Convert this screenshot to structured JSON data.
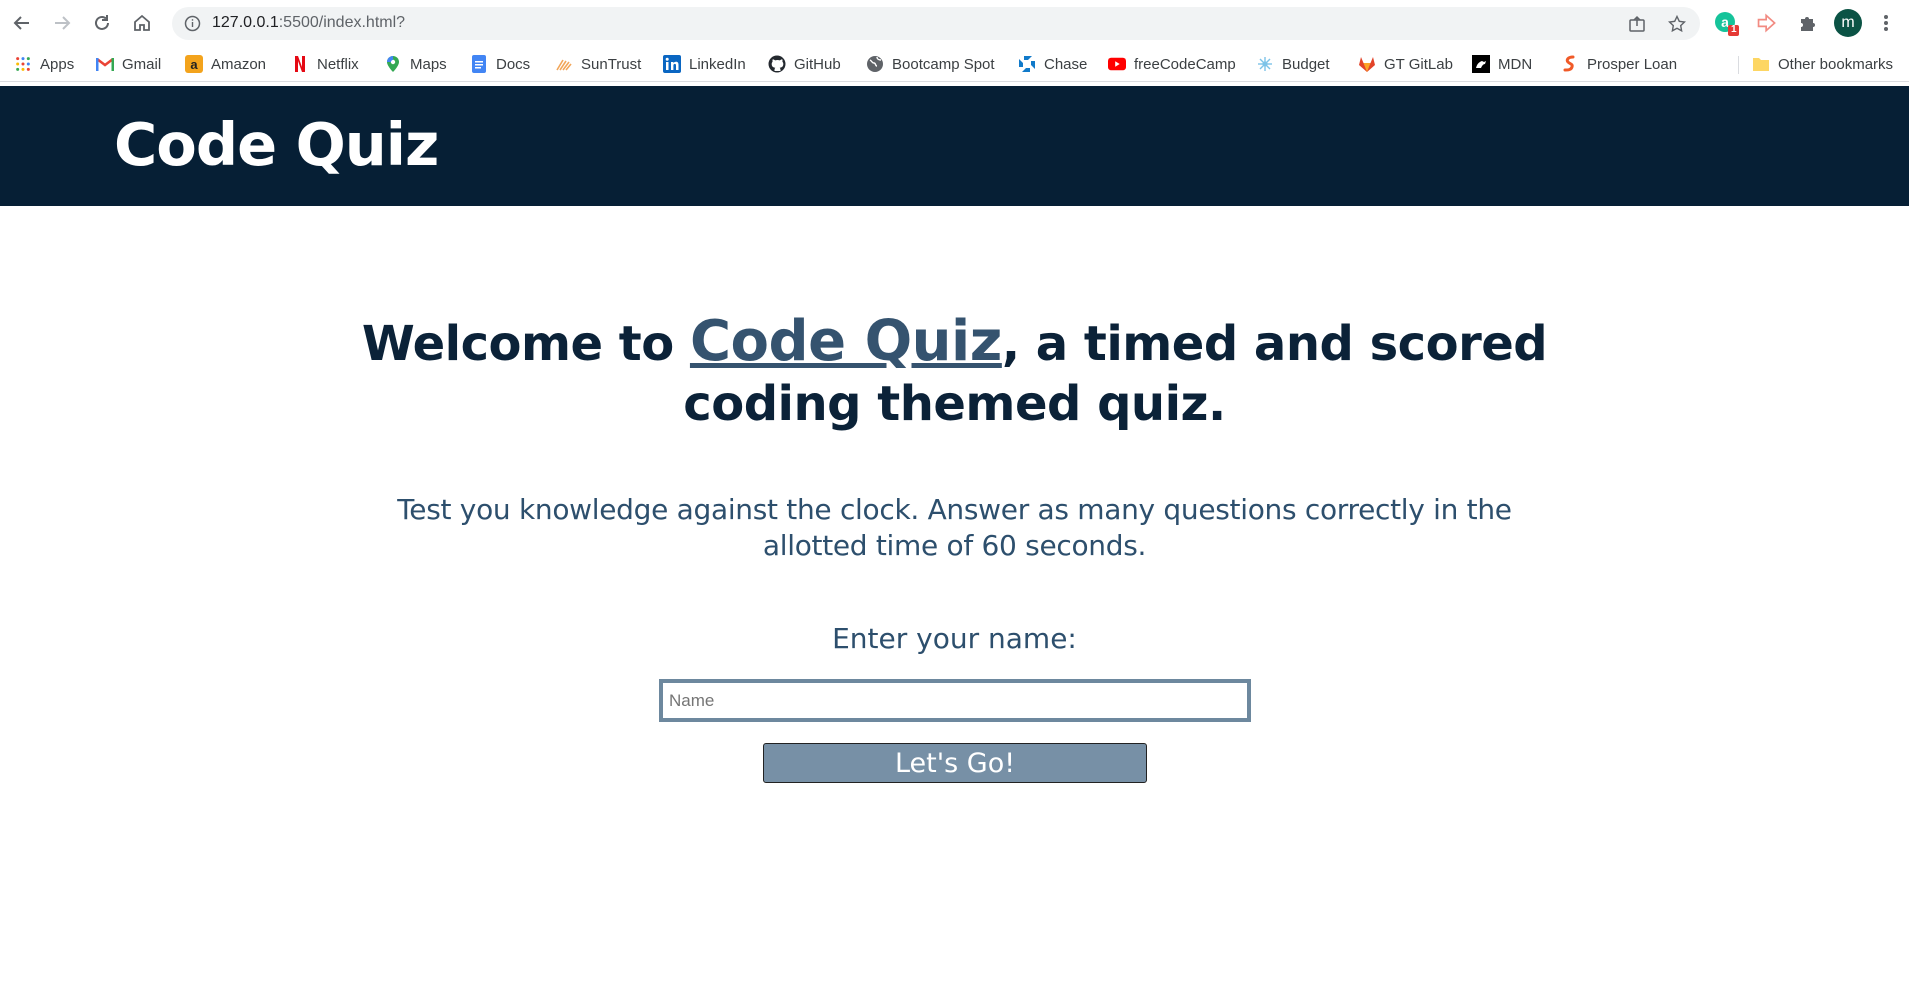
{
  "browser": {
    "url_host": "127.0.0.1",
    "url_rest": ":5500/index.html?",
    "avatar_letter": "m",
    "extension_badge": "1"
  },
  "bookmarks": [
    {
      "label": "Apps",
      "icon": "apps-grid-icon"
    },
    {
      "label": "Gmail",
      "icon": "gmail-icon"
    },
    {
      "label": "Amazon",
      "icon": "amazon-icon"
    },
    {
      "label": "Netflix",
      "icon": "netflix-icon"
    },
    {
      "label": "Maps",
      "icon": "maps-pin-icon"
    },
    {
      "label": "Docs",
      "icon": "docs-icon"
    },
    {
      "label": "SunTrust",
      "icon": "suntrust-icon"
    },
    {
      "label": "LinkedIn",
      "icon": "linkedin-icon"
    },
    {
      "label": "GitHub",
      "icon": "github-icon"
    },
    {
      "label": "Bootcamp Spot",
      "icon": "globe-icon"
    },
    {
      "label": "Chase",
      "icon": "chase-icon"
    },
    {
      "label": "freeCodeCamp",
      "icon": "youtube-icon"
    },
    {
      "label": "Budget",
      "icon": "budget-icon"
    },
    {
      "label": "GT GitLab",
      "icon": "gitlab-icon"
    },
    {
      "label": "MDN",
      "icon": "mdn-icon"
    },
    {
      "label": "Prosper Loan",
      "icon": "prosper-icon"
    }
  ],
  "other_bookmarks": "Other bookmarks",
  "header": {
    "title": "Code Quiz"
  },
  "main": {
    "welcome_pre": "Welcome to ",
    "welcome_link": "Code Quiz",
    "welcome_post": ", a timed and scored coding themed quiz.",
    "lead": "Test you knowledge against the clock. Answer as many questions correctly in the allotted time of 60 seconds.",
    "name_label": "Enter your name:",
    "name_placeholder": "Name",
    "name_value": "",
    "go_label": "Let's Go!"
  },
  "colors": {
    "header_bg": "#061f35",
    "heading_text": "#0b2238",
    "body_text": "#2d4f6d",
    "button_bg": "#7790a6",
    "input_border": "#6d889e"
  }
}
